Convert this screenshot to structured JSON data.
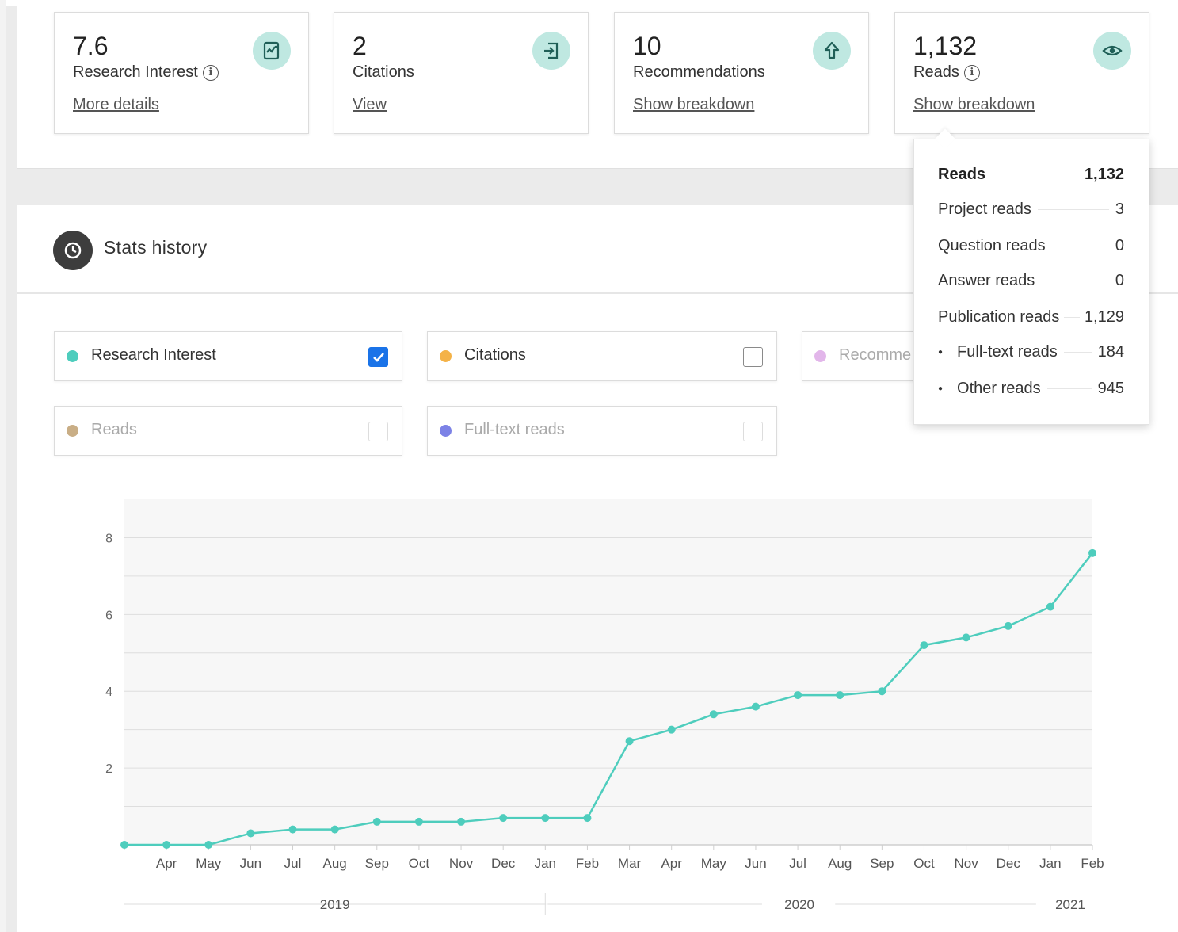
{
  "cards": [
    {
      "value": "7.6",
      "label": "Research Interest",
      "link": "More details",
      "icon": "research-interest-icon",
      "has_info": true
    },
    {
      "value": "2",
      "label": "Citations",
      "link": "View",
      "icon": "citations-icon",
      "has_info": false
    },
    {
      "value": "10",
      "label": "Recommendations",
      "link": "Show breakdown",
      "icon": "recommendations-arrow-up-icon",
      "has_info": false
    },
    {
      "value": "1,132",
      "label": "Reads",
      "link": "Show breakdown",
      "icon": "eye-icon",
      "has_info": true
    }
  ],
  "stats_history": {
    "title": "Stats history",
    "icon": "clock-icon"
  },
  "series_toggles": [
    {
      "label": "Research Interest",
      "color": "#4ecdbd",
      "checked": true,
      "enabled": true
    },
    {
      "label": "Citations",
      "color": "#f4b247",
      "checked": false,
      "enabled": true
    },
    {
      "label": "Recomme",
      "color": "#e2b6ea",
      "checked": false,
      "enabled": false
    },
    {
      "label": "Reads",
      "color": "#c9ae86",
      "checked": false,
      "enabled": false
    },
    {
      "label": "Full-text reads",
      "color": "#7c82e6",
      "checked": false,
      "enabled": false
    }
  ],
  "reads_breakdown": {
    "rows": [
      {
        "label": "Reads",
        "value": "1,132",
        "header": true
      },
      {
        "label": "Project reads",
        "value": "3"
      },
      {
        "label": "Question reads",
        "value": "0"
      },
      {
        "label": "Answer reads",
        "value": "0"
      },
      {
        "label": "Publication reads",
        "value": "1,129"
      },
      {
        "label": "Full-text reads",
        "value": "184",
        "bullet": true
      },
      {
        "label": "Other reads",
        "value": "945",
        "bullet": true
      }
    ]
  },
  "colors": {
    "accent": "#4ecdbd",
    "icon_bg": "#bfe8e1",
    "checkbox": "#1a73e8"
  },
  "chart_data": {
    "type": "line",
    "series": [
      {
        "name": "Research Interest",
        "values": [
          0,
          0,
          0,
          0.3,
          0.4,
          0.4,
          0.6,
          0.6,
          0.6,
          0.7,
          0.7,
          0.7,
          2.7,
          3.0,
          3.4,
          3.6,
          3.9,
          3.9,
          4.0,
          5.2,
          5.4,
          5.7,
          6.2,
          7.6
        ]
      }
    ],
    "categories": [
      "",
      "Apr",
      "May",
      "Jun",
      "Jul",
      "Aug",
      "Sep",
      "Oct",
      "Nov",
      "Dec",
      "Jan",
      "Feb",
      "Mar",
      "Apr",
      "May",
      "Jun",
      "Jul",
      "Aug",
      "Sep",
      "Oct",
      "Nov",
      "Dec",
      "Jan",
      "Feb"
    ],
    "years": [
      "2019",
      "2020",
      "2021"
    ],
    "yticks": [
      2,
      4,
      6,
      8
    ],
    "ylim": [
      0,
      9
    ],
    "grid": true
  }
}
